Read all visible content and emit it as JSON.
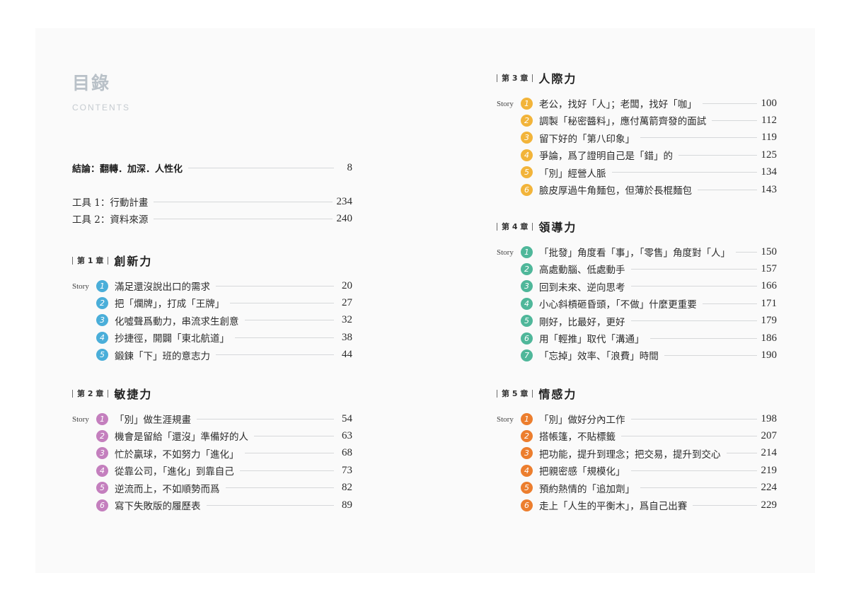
{
  "header": {
    "title": "目錄",
    "subtitle": "CONTENTS"
  },
  "intro": {
    "label": "結論：翻轉．加深．人性化",
    "page": "8"
  },
  "tools": [
    {
      "label": "工具 1：行動計畫",
      "page": "234"
    },
    {
      "label": "工具 2：資料來源",
      "page": "240"
    }
  ],
  "story_label": "Story",
  "chapters": [
    {
      "number": "第 1 章",
      "name": "創新力",
      "color": "#4aaed9",
      "items": [
        {
          "n": "1",
          "title": "滿足還沒說出口的需求",
          "page": "20"
        },
        {
          "n": "2",
          "title": "把「爛牌」，打成「王牌」",
          "page": "27"
        },
        {
          "n": "3",
          "title": "化噓聲爲動力，串流求生創意",
          "page": "32"
        },
        {
          "n": "4",
          "title": "抄捷徑，開闢「東北航道」",
          "page": "38"
        },
        {
          "n": "5",
          "title": "鍛鍊「下」班的意志力",
          "page": "44"
        }
      ]
    },
    {
      "number": "第 2 章",
      "name": "敏捷力",
      "color": "#c47fbe",
      "items": [
        {
          "n": "1",
          "title": "「別」做生涯規畫",
          "page": "54"
        },
        {
          "n": "2",
          "title": "機會是留給「還沒」準備好的人",
          "page": "63"
        },
        {
          "n": "3",
          "title": "忙於贏球，不如努力「進化」",
          "page": "68"
        },
        {
          "n": "4",
          "title": "從靠公司，「進化」到靠自己",
          "page": "73"
        },
        {
          "n": "5",
          "title": "逆流而上，不如順勢而爲",
          "page": "82"
        },
        {
          "n": "6",
          "title": "寫下失敗版的履歷表",
          "page": "89"
        }
      ]
    },
    {
      "number": "第 3 章",
      "name": "人際力",
      "color": "#f2b43a",
      "items": [
        {
          "n": "1",
          "title": "老公，找好「人」；老闆，找好「咖」",
          "page": "100"
        },
        {
          "n": "2",
          "title": "調製「秘密醬料」，應付萬箭齊發的面試",
          "page": "112"
        },
        {
          "n": "3",
          "title": "留下好的「第八印象」",
          "page": "119"
        },
        {
          "n": "4",
          "title": "爭論，爲了證明自己是「錯」的",
          "page": "125"
        },
        {
          "n": "5",
          "title": "「別」經營人脈",
          "page": "134"
        },
        {
          "n": "6",
          "title": "臉皮厚過牛角麵包，但薄於長棍麵包",
          "page": "143"
        }
      ]
    },
    {
      "number": "第 4 章",
      "name": "領導力",
      "color": "#4fb79a",
      "items": [
        {
          "n": "1",
          "title": "「批發」角度看「事」，「零售」角度對「人」",
          "page": "150"
        },
        {
          "n": "2",
          "title": "高處動腦、低處動手",
          "page": "157"
        },
        {
          "n": "3",
          "title": "回到未來、逆向思考",
          "page": "166"
        },
        {
          "n": "4",
          "title": "小心斜槓砸昏頭，「不做」什麼更重要",
          "page": "171"
        },
        {
          "n": "5",
          "title": "剛好，比最好，更好",
          "page": "179"
        },
        {
          "n": "6",
          "title": "用「輕推」取代「溝通」",
          "page": "186"
        },
        {
          "n": "7",
          "title": "「忘掉」效率、「浪費」時間",
          "page": "190"
        }
      ]
    },
    {
      "number": "第 5 章",
      "name": "情感力",
      "color": "#ec7e2e",
      "items": [
        {
          "n": "1",
          "title": "「別」做好分內工作",
          "page": "198"
        },
        {
          "n": "2",
          "title": "搭帳篷，不貼標籤",
          "page": "207"
        },
        {
          "n": "3",
          "title": "把功能，提升到理念；把交易，提升到交心",
          "page": "214"
        },
        {
          "n": "4",
          "title": "把親密感「規模化」",
          "page": "219"
        },
        {
          "n": "5",
          "title": "預約熱情的「追加劑」",
          "page": "224"
        },
        {
          "n": "6",
          "title": "走上「人生的平衡木」，爲自己出賽",
          "page": "229"
        }
      ]
    }
  ]
}
